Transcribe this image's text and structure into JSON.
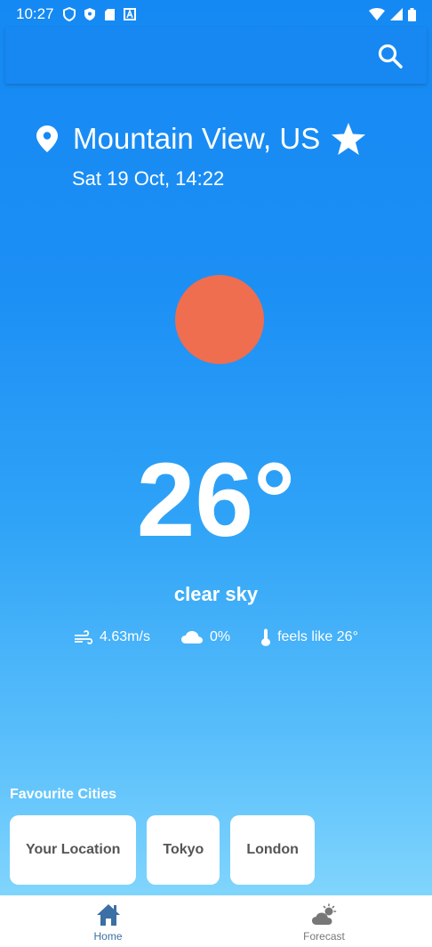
{
  "status_bar": {
    "time": "10:27"
  },
  "location": {
    "city": "Mountain View, US",
    "datetime": "Sat 19 Oct, 14:22"
  },
  "weather": {
    "temperature": "26°",
    "condition": "clear sky",
    "wind": "4.63m/s",
    "clouds": "0%",
    "feels_like": "feels like 26°"
  },
  "favourites": {
    "title": "Favourite Cities",
    "cities": [
      "Your Location",
      "Tokyo",
      "London"
    ]
  },
  "nav": {
    "home": "Home",
    "forecast": "Forecast"
  },
  "colors": {
    "sun": "#ee6e4f",
    "nav_active": "#3c6fa3"
  }
}
